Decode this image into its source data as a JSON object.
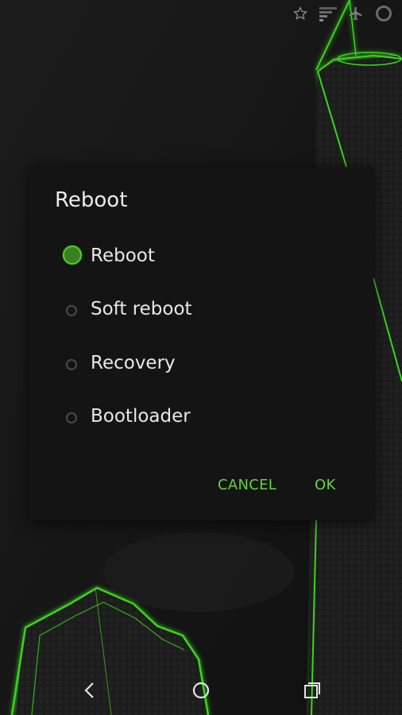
{
  "colors": {
    "accent": "#5fd63a",
    "glow": "#3bd41c",
    "dialog_bg": "#141414",
    "text": "#e8e8e8"
  },
  "status_bar": {
    "icons": [
      "star-icon",
      "signal-icon",
      "airplane-mode-icon",
      "battery-ring-icon"
    ]
  },
  "dialog": {
    "title": "Reboot",
    "options": [
      {
        "label": "Reboot",
        "selected": true
      },
      {
        "label": "Soft reboot",
        "selected": false
      },
      {
        "label": "Recovery",
        "selected": false
      },
      {
        "label": "Bootloader",
        "selected": false
      }
    ],
    "cancel_label": "CANCEL",
    "ok_label": "OK"
  },
  "nav_bar": {
    "icons": [
      "back-icon",
      "home-icon",
      "recents-icon"
    ]
  }
}
